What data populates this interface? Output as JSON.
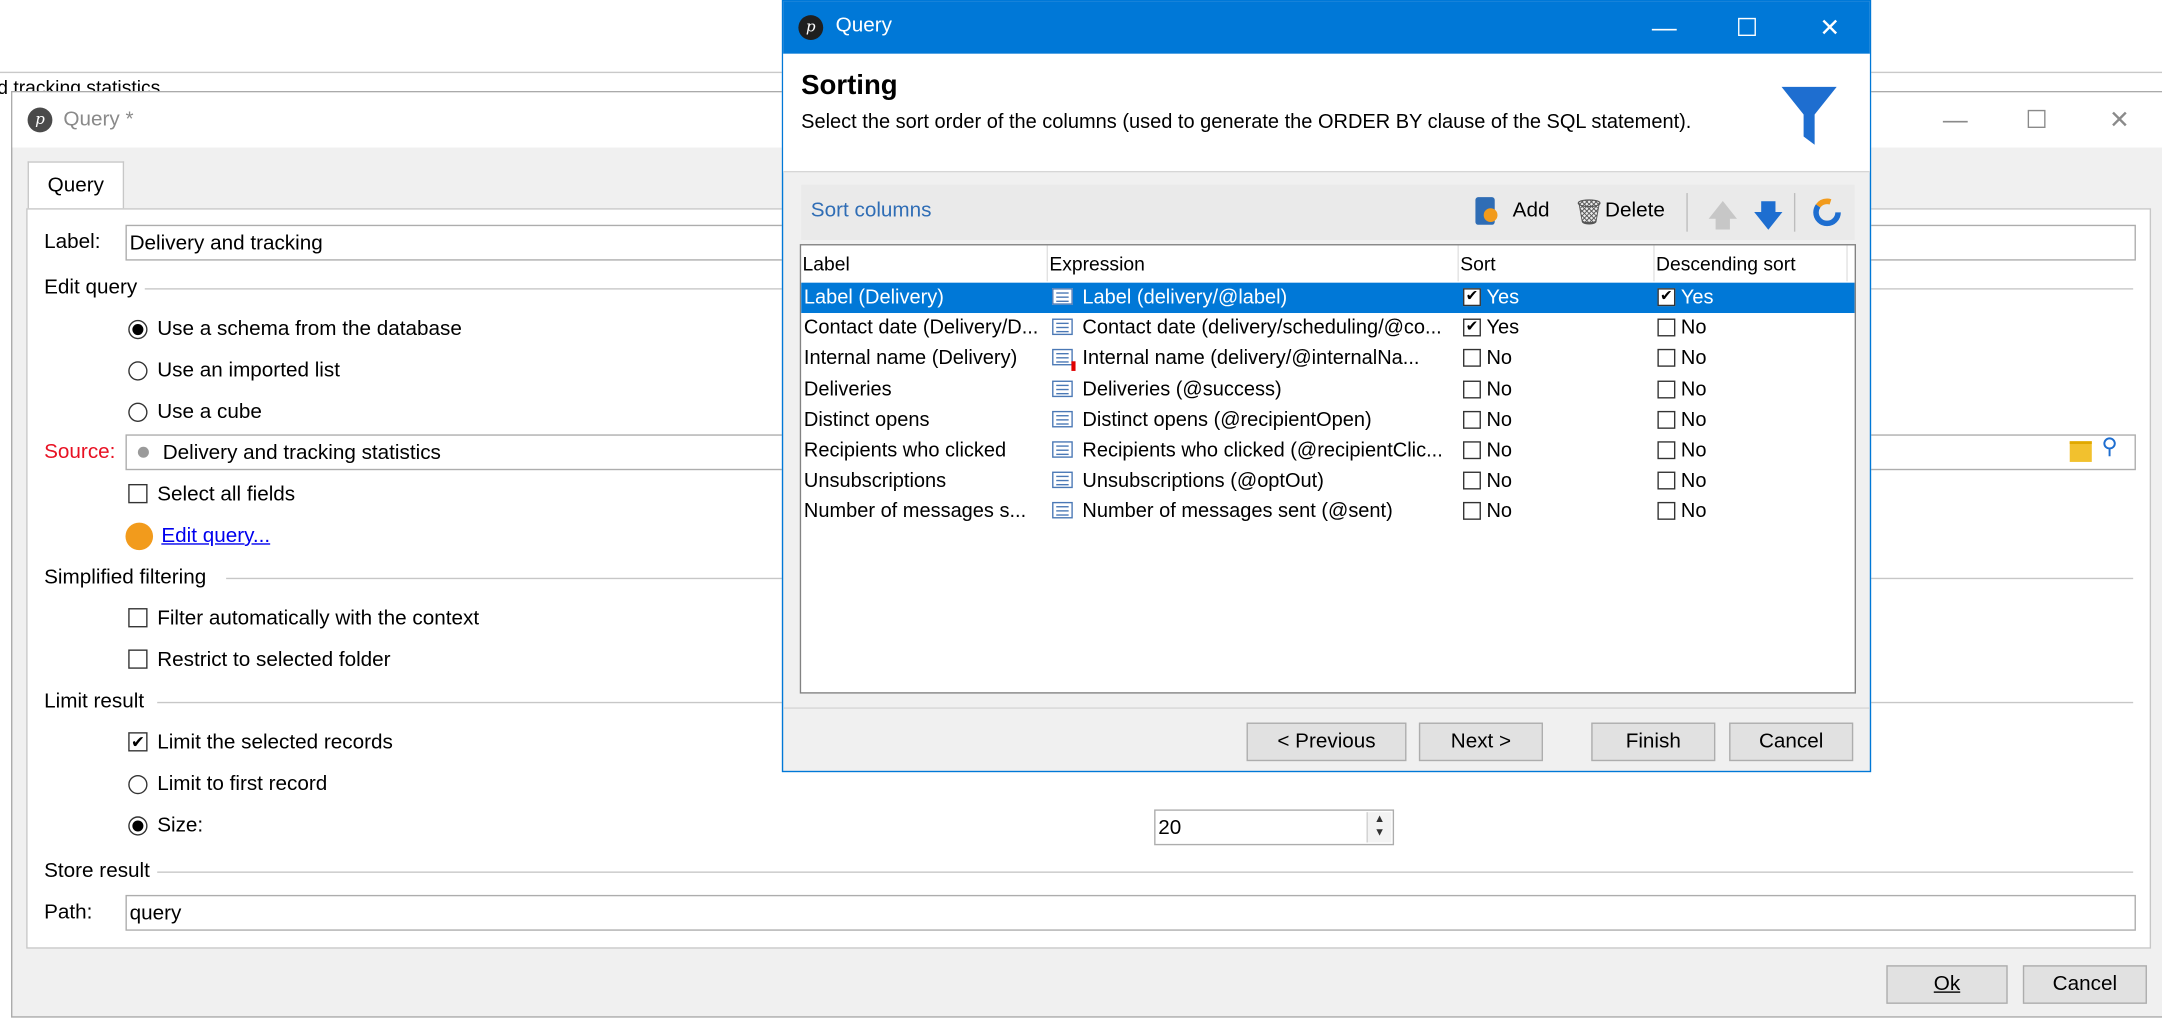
{
  "background_window": {
    "title_fragment": "d tracking statistics"
  },
  "main_window": {
    "title": "Query *",
    "tab": "Query",
    "label_caption": "Label:",
    "label_value": "Delivery and tracking",
    "edit_query_group": "Edit query",
    "radio_schema": "Use a schema from the database",
    "radio_imported": "Use an imported list",
    "radio_cube": "Use a cube",
    "source_caption": "Source:",
    "source_value": "Delivery and tracking statistics",
    "select_all_fields": "Select all fields",
    "edit_query_link": "Edit query...",
    "simplified_filtering_group": "Simplified filtering",
    "filter_auto": "Filter automatically with the context",
    "restrict_folder": "Restrict to selected folder",
    "limit_result_group": "Limit result",
    "limit_selected": "Limit the selected records",
    "limit_first": "Limit to first record",
    "size_caption": "Size:",
    "size_value": "20",
    "store_result_group": "Store result",
    "path_caption": "Path:",
    "path_value": "query",
    "ok_button": "Ok",
    "cancel_button": "Cancel",
    "accent_color": "#f29b1c"
  },
  "dialog": {
    "title": "Query",
    "heading": "Sorting",
    "description": "Select the sort order of the columns (used to generate the ORDER BY clause of the SQL statement).",
    "section_title": "Sort columns",
    "add_label": "Add",
    "delete_label": "Delete",
    "columns": [
      "Label",
      "Expression",
      "Sort",
      "Descending sort"
    ],
    "rows": [
      {
        "label": "Label (Delivery)",
        "expression": "Label (delivery/@label)",
        "sort": "Yes",
        "sort_checked": true,
        "desc": "Yes",
        "desc_checked": true,
        "selected": true
      },
      {
        "label": "Contact date (Delivery/D...",
        "expression": "Contact date (delivery/scheduling/@co...",
        "sort": "Yes",
        "sort_checked": true,
        "desc": "No",
        "desc_checked": false
      },
      {
        "label": "Internal name (Delivery)",
        "expression": "Internal name (delivery/@internalNa...",
        "sort": "No",
        "sort_checked": false,
        "desc": "No",
        "desc_checked": false
      },
      {
        "label": "Deliveries",
        "expression": "Deliveries (@success)",
        "sort": "No",
        "sort_checked": false,
        "desc": "No",
        "desc_checked": false
      },
      {
        "label": "Distinct opens",
        "expression": "Distinct opens (@recipientOpen)",
        "sort": "No",
        "sort_checked": false,
        "desc": "No",
        "desc_checked": false
      },
      {
        "label": "Recipients who clicked",
        "expression": "Recipients who clicked (@recipientClic...",
        "sort": "No",
        "sort_checked": false,
        "desc": "No",
        "desc_checked": false
      },
      {
        "label": "Unsubscriptions",
        "expression": "Unsubscriptions (@optOut)",
        "sort": "No",
        "sort_checked": false,
        "desc": "No",
        "desc_checked": false
      },
      {
        "label": "Number of messages s...",
        "expression": "Number of messages sent (@sent)",
        "sort": "No",
        "sort_checked": false,
        "desc": "No",
        "desc_checked": false
      }
    ],
    "previous_button": "< Previous",
    "next_button": "Next >",
    "finish_button": "Finish",
    "cancel_button": "Cancel",
    "title_bar_color": "#0078d7",
    "selection_color": "#0078d7"
  }
}
